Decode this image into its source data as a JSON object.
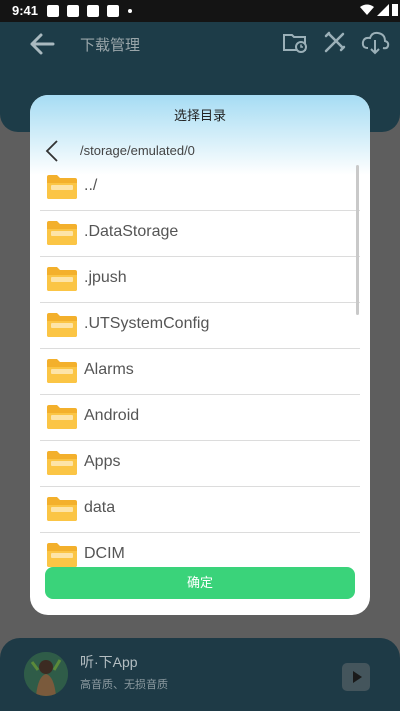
{
  "status_bar": {
    "time": "9:41"
  },
  "app_bar": {
    "title": "下载管理",
    "icons": [
      "back-arrow-icon",
      "folder-clock-icon",
      "tools-icon",
      "cloud-download-icon"
    ]
  },
  "dialog": {
    "title": "选择目录",
    "path": "/storage/emulated/0",
    "items": [
      {
        "label": "../"
      },
      {
        "label": ".DataStorage"
      },
      {
        "label": ".jpush"
      },
      {
        "label": ".UTSystemConfig"
      },
      {
        "label": "Alarms"
      },
      {
        "label": "Android"
      },
      {
        "label": "Apps"
      },
      {
        "label": "data"
      },
      {
        "label": "DCIM"
      }
    ],
    "confirm_label": "确定"
  },
  "player": {
    "title": "听·下App",
    "subtitle": "高音质、无损音质"
  },
  "colors": {
    "accent_green": "#3AD37A",
    "app_bar": "#1D3C48",
    "folder": "#F6B532"
  }
}
